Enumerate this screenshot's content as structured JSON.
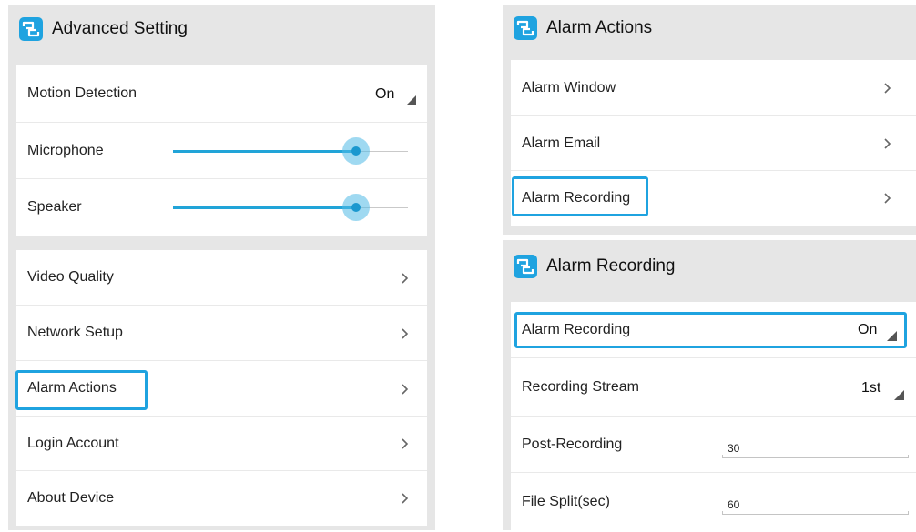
{
  "colors": {
    "accent": "#1fa3e0",
    "panel_bg": "#e6e6e6",
    "card_bg": "#ffffff",
    "slider_fill": "#21a4d8"
  },
  "advanced": {
    "title": "Advanced Setting",
    "logo_icon": "app-logo-icon",
    "controls": {
      "motion_label": "Motion Detection",
      "motion_value": "On",
      "microphone_label": "Microphone",
      "microphone_level": 0.78,
      "speaker_label": "Speaker",
      "speaker_level": 0.78
    },
    "menu": [
      {
        "label": "Video Quality",
        "icon": "chevron-right-icon"
      },
      {
        "label": "Network Setup",
        "icon": "chevron-right-icon"
      },
      {
        "label": "Alarm Actions",
        "icon": "chevron-right-icon",
        "highlighted": true
      },
      {
        "label": "Login Account",
        "icon": "chevron-right-icon"
      },
      {
        "label": "About Device",
        "icon": "chevron-right-icon"
      }
    ]
  },
  "alarm_actions": {
    "title": "Alarm Actions",
    "items": [
      {
        "label": "Alarm Window",
        "icon": "chevron-right-icon"
      },
      {
        "label": "Alarm Email",
        "icon": "chevron-right-icon"
      },
      {
        "label": "Alarm Recording",
        "icon": "chevron-right-icon",
        "highlighted": true
      }
    ]
  },
  "alarm_recording": {
    "title": "Alarm Recording",
    "alarm_recording_label": "Alarm Recording",
    "alarm_recording_value": "On",
    "stream_label": "Recording Stream",
    "stream_value": "1st",
    "post_label": "Post-Recording",
    "post_value": "30",
    "split_label": "File Split(sec)",
    "split_value": "60"
  }
}
